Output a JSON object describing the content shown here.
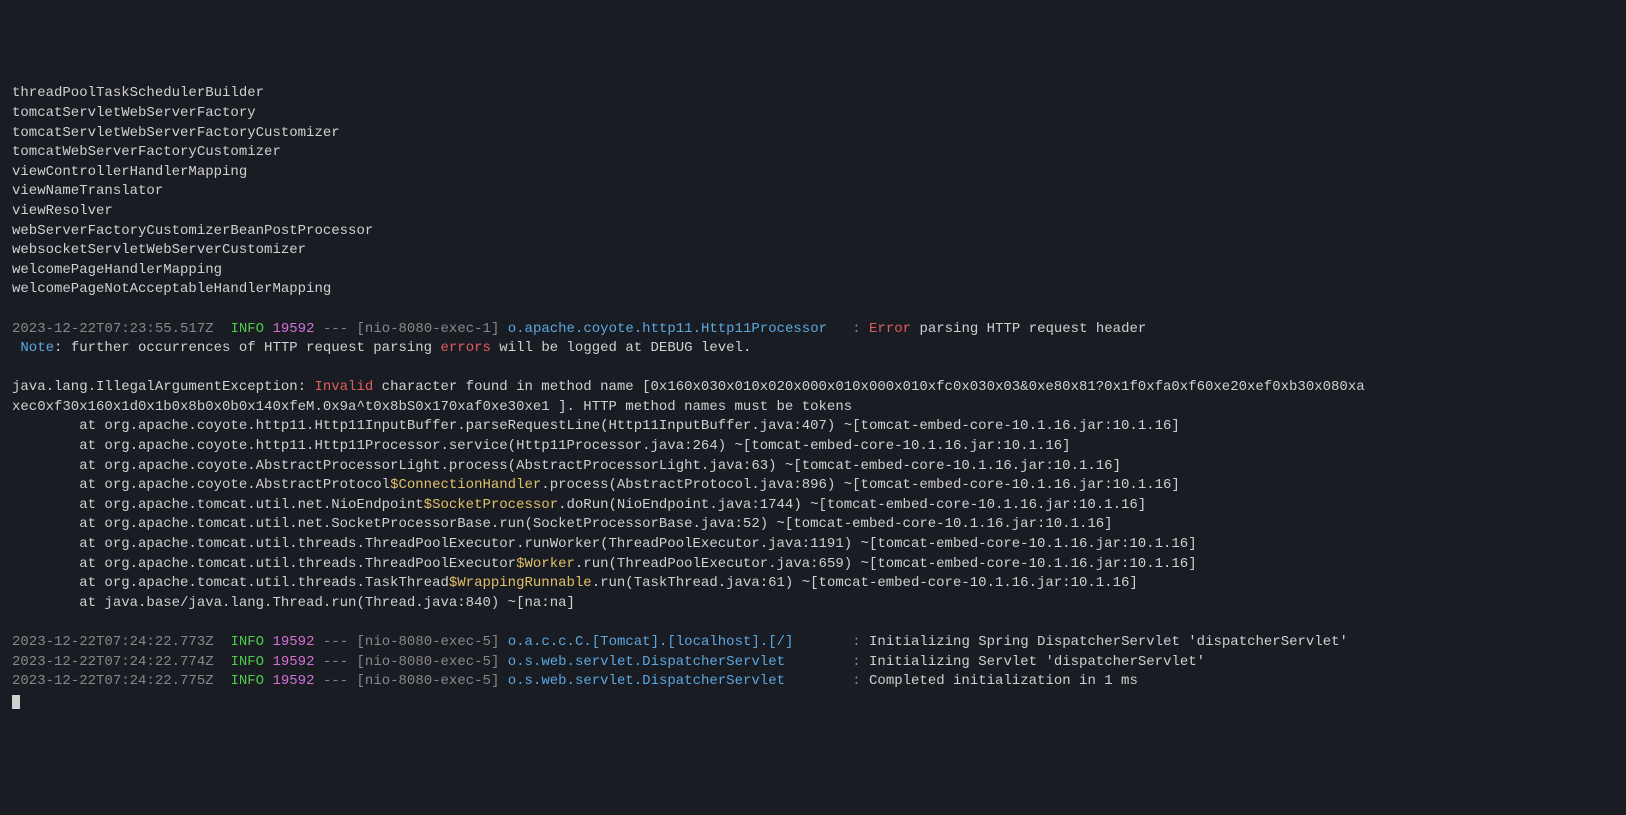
{
  "beans": [
    "threadPoolTaskSchedulerBuilder",
    "tomcatServletWebServerFactory",
    "tomcatServletWebServerFactoryCustomizer",
    "tomcatWebServerFactoryCustomizer",
    "viewControllerHandlerMapping",
    "viewNameTranslator",
    "viewResolver",
    "webServerFactoryCustomizerBeanPostProcessor",
    "websocketServletWebServerCustomizer",
    "welcomePageHandlerMapping",
    "welcomePageNotAcceptableHandlerMapping"
  ],
  "log1": {
    "ts": "2023-12-22T07:23:55.517Z",
    "level": "INFO",
    "pid": "19592",
    "dash": "---",
    "thread": "[nio-8080-exec-1]",
    "logger": "o.apache.coyote.http11.Http11Processor",
    "colon": "   :",
    "err": " Error",
    "msg": " parsing HTTP request header"
  },
  "note": {
    "label": " Note",
    "mid1": ": further occurrences of HTTP request parsing ",
    "errors": "errors",
    "mid2": " will be logged at DEBUG level."
  },
  "exc": {
    "head1": "java.lang.IllegalArgumentException: ",
    "invalid": "Invalid",
    "head2": " character found in method name [0x160x030x010x020x000x010x000x010xfc0x030x03&0xe80x81?0x1f0xfa0xf60xe20xef0xb30x080xa",
    "head3": "xec0xf30x160x1d0x1b0x8b0x0b0x140xfeM.0x9a^t0x8bS0x170xaf0xe30xe1 ]. HTTP method names must be tokens"
  },
  "stack": [
    {
      "pre": "        at org.apache.coyote.http11.Http11InputBuffer.parseRequestLine(Http11InputBuffer.java:407) ~[tomcat-embed-core-10.1.16.jar:10.1.16]",
      "inner": ""
    },
    {
      "pre": "        at org.apache.coyote.http11.Http11Processor.service(Http11Processor.java:264) ~[tomcat-embed-core-10.1.16.jar:10.1.16]",
      "inner": ""
    },
    {
      "pre": "        at org.apache.coyote.AbstractProcessorLight.process(AbstractProcessorLight.java:63) ~[tomcat-embed-core-10.1.16.jar:10.1.16]",
      "inner": ""
    },
    {
      "pre": "        at org.apache.coyote.AbstractProtocol",
      "inner": "$ConnectionHandler",
      "post": ".process(AbstractProtocol.java:896) ~[tomcat-embed-core-10.1.16.jar:10.1.16]"
    },
    {
      "pre": "        at org.apache.tomcat.util.net.NioEndpoint",
      "inner": "$SocketProcessor",
      "post": ".doRun(NioEndpoint.java:1744) ~[tomcat-embed-core-10.1.16.jar:10.1.16]"
    },
    {
      "pre": "        at org.apache.tomcat.util.net.SocketProcessorBase.run(SocketProcessorBase.java:52) ~[tomcat-embed-core-10.1.16.jar:10.1.16]",
      "inner": ""
    },
    {
      "pre": "        at org.apache.tomcat.util.threads.ThreadPoolExecutor.runWorker(ThreadPoolExecutor.java:1191) ~[tomcat-embed-core-10.1.16.jar:10.1.16]",
      "inner": ""
    },
    {
      "pre": "        at org.apache.tomcat.util.threads.ThreadPoolExecutor",
      "inner": "$Worker",
      "post": ".run(ThreadPoolExecutor.java:659) ~[tomcat-embed-core-10.1.16.jar:10.1.16]"
    },
    {
      "pre": "        at org.apache.tomcat.util.threads.TaskThread",
      "inner": "$WrappingRunnable",
      "post": ".run(TaskThread.java:61) ~[tomcat-embed-core-10.1.16.jar:10.1.16]"
    },
    {
      "pre": "        at java.base/java.lang.Thread.run(Thread.java:840) ~[na:na]",
      "inner": ""
    }
  ],
  "tail": [
    {
      "ts": "2023-12-22T07:24:22.773Z",
      "level": "INFO",
      "pid": "19592",
      "dash": "---",
      "thread": "[nio-8080-exec-5]",
      "logger": "o.a.c.c.C.[Tomcat].[localhost].[/]",
      "pad": "       : ",
      "msg": "Initializing Spring DispatcherServlet 'dispatcherServlet'"
    },
    {
      "ts": "2023-12-22T07:24:22.774Z",
      "level": "INFO",
      "pid": "19592",
      "dash": "---",
      "thread": "[nio-8080-exec-5]",
      "logger": "o.s.web.servlet.DispatcherServlet",
      "pad": "        : ",
      "msg": "Initializing Servlet 'dispatcherServlet'"
    },
    {
      "ts": "2023-12-22T07:24:22.775Z",
      "level": "INFO",
      "pid": "19592",
      "dash": "---",
      "thread": "[nio-8080-exec-5]",
      "logger": "o.s.web.servlet.DispatcherServlet",
      "pad": "        : ",
      "msg": "Completed initialization in 1 ms"
    }
  ]
}
